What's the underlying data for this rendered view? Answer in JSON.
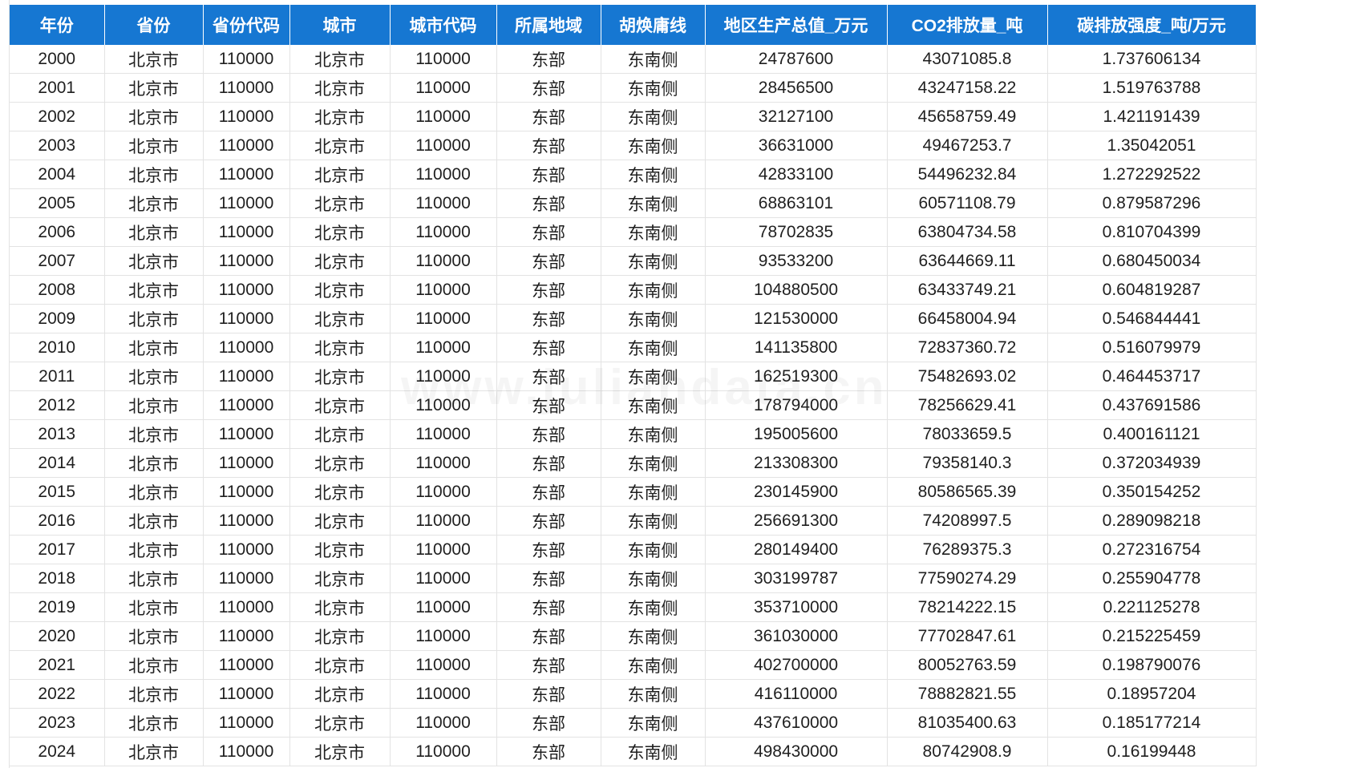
{
  "watermark": "www.juliandata.cn",
  "columns": [
    "年份",
    "省份",
    "省份代码",
    "城市",
    "城市代码",
    "所属地域",
    "胡焕庸线",
    "地区生产总值_万元",
    "CO2排放量_吨",
    "碳排放强度_吨/万元"
  ],
  "rows": [
    [
      "2000",
      "北京市",
      "110000",
      "北京市",
      "110000",
      "东部",
      "东南侧",
      "24787600",
      "43071085.8",
      "1.737606134"
    ],
    [
      "2001",
      "北京市",
      "110000",
      "北京市",
      "110000",
      "东部",
      "东南侧",
      "28456500",
      "43247158.22",
      "1.519763788"
    ],
    [
      "2002",
      "北京市",
      "110000",
      "北京市",
      "110000",
      "东部",
      "东南侧",
      "32127100",
      "45658759.49",
      "1.421191439"
    ],
    [
      "2003",
      "北京市",
      "110000",
      "北京市",
      "110000",
      "东部",
      "东南侧",
      "36631000",
      "49467253.7",
      "1.35042051"
    ],
    [
      "2004",
      "北京市",
      "110000",
      "北京市",
      "110000",
      "东部",
      "东南侧",
      "42833100",
      "54496232.84",
      "1.272292522"
    ],
    [
      "2005",
      "北京市",
      "110000",
      "北京市",
      "110000",
      "东部",
      "东南侧",
      "68863101",
      "60571108.79",
      "0.879587296"
    ],
    [
      "2006",
      "北京市",
      "110000",
      "北京市",
      "110000",
      "东部",
      "东南侧",
      "78702835",
      "63804734.58",
      "0.810704399"
    ],
    [
      "2007",
      "北京市",
      "110000",
      "北京市",
      "110000",
      "东部",
      "东南侧",
      "93533200",
      "63644669.11",
      "0.680450034"
    ],
    [
      "2008",
      "北京市",
      "110000",
      "北京市",
      "110000",
      "东部",
      "东南侧",
      "104880500",
      "63433749.21",
      "0.604819287"
    ],
    [
      "2009",
      "北京市",
      "110000",
      "北京市",
      "110000",
      "东部",
      "东南侧",
      "121530000",
      "66458004.94",
      "0.546844441"
    ],
    [
      "2010",
      "北京市",
      "110000",
      "北京市",
      "110000",
      "东部",
      "东南侧",
      "141135800",
      "72837360.72",
      "0.516079979"
    ],
    [
      "2011",
      "北京市",
      "110000",
      "北京市",
      "110000",
      "东部",
      "东南侧",
      "162519300",
      "75482693.02",
      "0.464453717"
    ],
    [
      "2012",
      "北京市",
      "110000",
      "北京市",
      "110000",
      "东部",
      "东南侧",
      "178794000",
      "78256629.41",
      "0.437691586"
    ],
    [
      "2013",
      "北京市",
      "110000",
      "北京市",
      "110000",
      "东部",
      "东南侧",
      "195005600",
      "78033659.5",
      "0.400161121"
    ],
    [
      "2014",
      "北京市",
      "110000",
      "北京市",
      "110000",
      "东部",
      "东南侧",
      "213308300",
      "79358140.3",
      "0.372034939"
    ],
    [
      "2015",
      "北京市",
      "110000",
      "北京市",
      "110000",
      "东部",
      "东南侧",
      "230145900",
      "80586565.39",
      "0.350154252"
    ],
    [
      "2016",
      "北京市",
      "110000",
      "北京市",
      "110000",
      "东部",
      "东南侧",
      "256691300",
      "74208997.5",
      "0.289098218"
    ],
    [
      "2017",
      "北京市",
      "110000",
      "北京市",
      "110000",
      "东部",
      "东南侧",
      "280149400",
      "76289375.3",
      "0.272316754"
    ],
    [
      "2018",
      "北京市",
      "110000",
      "北京市",
      "110000",
      "东部",
      "东南侧",
      "303199787",
      "77590274.29",
      "0.255904778"
    ],
    [
      "2019",
      "北京市",
      "110000",
      "北京市",
      "110000",
      "东部",
      "东南侧",
      "353710000",
      "78214222.15",
      "0.221125278"
    ],
    [
      "2020",
      "北京市",
      "110000",
      "北京市",
      "110000",
      "东部",
      "东南侧",
      "361030000",
      "77702847.61",
      "0.215225459"
    ],
    [
      "2021",
      "北京市",
      "110000",
      "北京市",
      "110000",
      "东部",
      "东南侧",
      "402700000",
      "80052763.59",
      "0.198790076"
    ],
    [
      "2022",
      "北京市",
      "110000",
      "北京市",
      "110000",
      "东部",
      "东南侧",
      "416110000",
      "78882821.55",
      "0.18957204"
    ],
    [
      "2023",
      "北京市",
      "110000",
      "北京市",
      "110000",
      "东部",
      "东南侧",
      "437610000",
      "81035400.63",
      "0.185177214"
    ],
    [
      "2024",
      "北京市",
      "110000",
      "北京市",
      "110000",
      "东部",
      "东南侧",
      "498430000",
      "80742908.9",
      "0.16199448"
    ]
  ],
  "colors": {
    "header_bg": "#1677d2",
    "header_text": "#ffffff",
    "grid_line": "#e3e3e3",
    "cell_text": "#1f1f1f"
  }
}
